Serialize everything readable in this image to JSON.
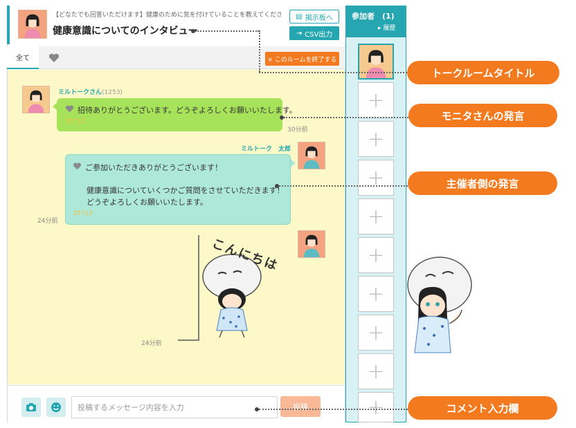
{
  "header": {
    "subtitle": "【どなたでも回答いただけます】健康のために気を付けていることを教えてください。",
    "title": "健康意識についてのインタビュー",
    "board_button": "掲示板へ",
    "csv_button": "CSV出力"
  },
  "tabs": {
    "all": "全て"
  },
  "end_room_button": "× このルームを終了する",
  "messages": [
    {
      "sender": "ミルトークさん",
      "sender_count": "(1253)",
      "line1": "招待ありがとうございます。どうぞよろしくお願いいたします。",
      "number": "35712",
      "time": "30分前"
    },
    {
      "sender": "ミルトーク　太郎",
      "line1": "ご参加いただきありがとうございます！",
      "line2": "健康意識についていくつかご質問をさせていただきます！",
      "line3": "どうぞよろしくお願いいたします。",
      "number": "35713",
      "time": "24分前"
    },
    {
      "sticker_text": "こんにちは",
      "time": "24分前"
    }
  ],
  "input": {
    "placeholder": "投稿するメッセージ内容を入力",
    "post_button": "投稿"
  },
  "participants": {
    "title": "参加者",
    "count": "(1)",
    "history": "▸ 履歴",
    "add_symbol": "+"
  },
  "callouts": {
    "room_title": "トークルームタイトル",
    "monitor": "モニタさんの発言",
    "organizer": "主催者側の発言",
    "comment": "コメント入力欄"
  },
  "colors": {
    "accent": "#26a6b0",
    "orange": "#f47a20",
    "chat_bg": "#fdf8c8",
    "monitor_bubble": "#a6e25a",
    "organizer_bubble": "#aee8d8"
  }
}
